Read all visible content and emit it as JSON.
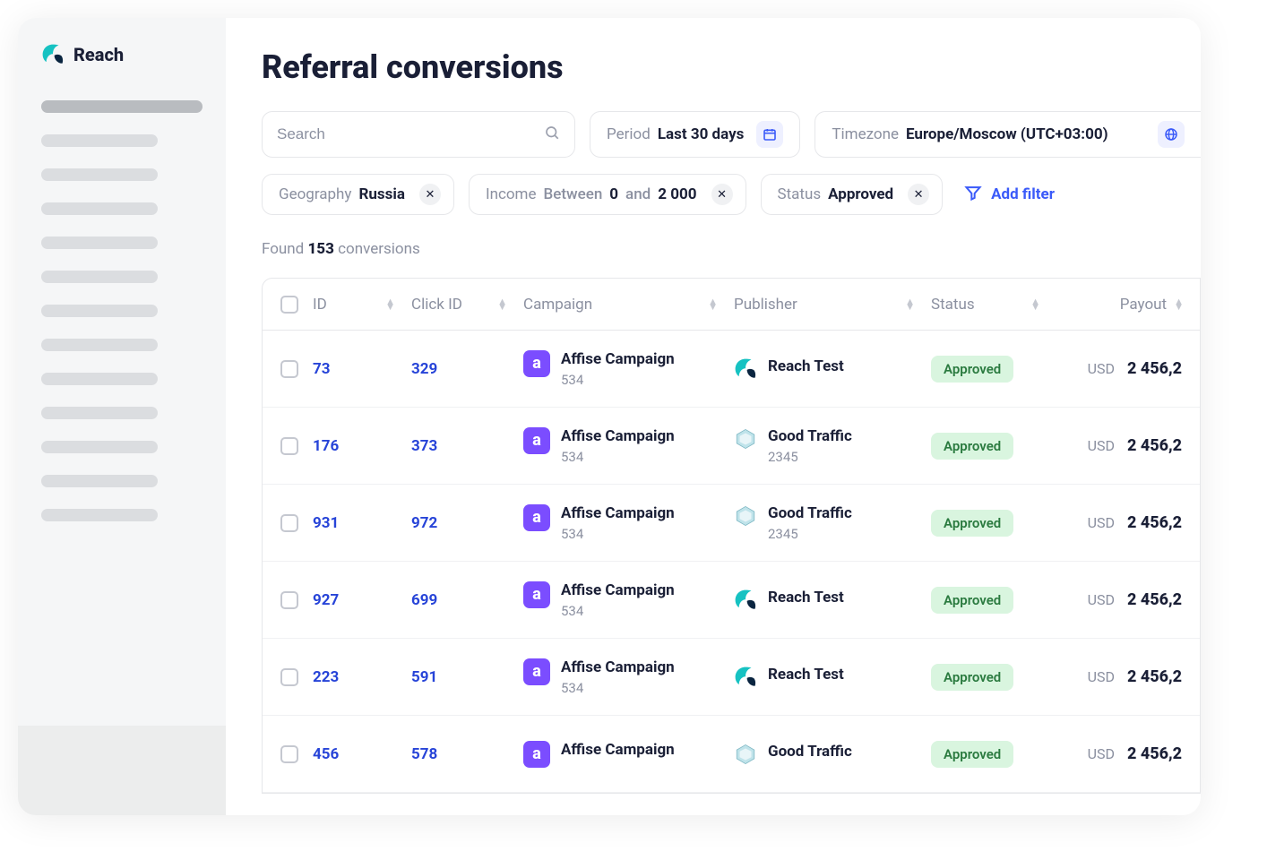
{
  "app_name": "Reach",
  "page_title": "Referral conversions",
  "search": {
    "placeholder": "Search"
  },
  "period": {
    "label": "Period",
    "value": "Last 30 days"
  },
  "timezone": {
    "label": "Timezone",
    "value": "Europe/Moscow (UTC+03:00)"
  },
  "filters": {
    "geography": {
      "label": "Geography",
      "value": "Russia"
    },
    "income": {
      "label": "Income",
      "between": "Between",
      "low": "0",
      "and": "and",
      "high": "2 000"
    },
    "status": {
      "label": "Status",
      "value": "Approved"
    }
  },
  "add_filter_label": "Add filter",
  "found": {
    "prefix": "Found",
    "count": "153",
    "suffix": "conversions"
  },
  "columns": {
    "id": "ID",
    "click_id": "Click ID",
    "campaign": "Campaign",
    "publisher": "Publisher",
    "status": "Status",
    "payout": "Payout"
  },
  "rows": [
    {
      "id": "73",
      "click_id": "329",
      "campaign_name": "Affise Campaign",
      "campaign_sub": "534",
      "publisher_name": "Reach Test",
      "publisher_sub": "",
      "publisher_logo": "reach",
      "status": "Approved",
      "payout_currency": "USD",
      "payout_value": "2 456,2"
    },
    {
      "id": "176",
      "click_id": "373",
      "campaign_name": "Affise Campaign",
      "campaign_sub": "534",
      "publisher_name": "Good Traffic",
      "publisher_sub": "2345",
      "publisher_logo": "gt",
      "status": "Approved",
      "payout_currency": "USD",
      "payout_value": "2 456,2"
    },
    {
      "id": "931",
      "click_id": "972",
      "campaign_name": "Affise Campaign",
      "campaign_sub": "534",
      "publisher_name": "Good Traffic",
      "publisher_sub": "2345",
      "publisher_logo": "gt",
      "status": "Approved",
      "payout_currency": "USD",
      "payout_value": "2 456,2"
    },
    {
      "id": "927",
      "click_id": "699",
      "campaign_name": "Affise Campaign",
      "campaign_sub": "534",
      "publisher_name": "Reach Test",
      "publisher_sub": "",
      "publisher_logo": "reach",
      "status": "Approved",
      "payout_currency": "USD",
      "payout_value": "2 456,2"
    },
    {
      "id": "223",
      "click_id": "591",
      "campaign_name": "Affise Campaign",
      "campaign_sub": "534",
      "publisher_name": "Reach Test",
      "publisher_sub": "",
      "publisher_logo": "reach",
      "status": "Approved",
      "payout_currency": "USD",
      "payout_value": "2 456,2"
    },
    {
      "id": "456",
      "click_id": "578",
      "campaign_name": "Affise Campaign",
      "campaign_sub": "",
      "publisher_name": "Good Traffic",
      "publisher_sub": "",
      "publisher_logo": "gt",
      "status": "Approved",
      "payout_currency": "USD",
      "payout_value": "2 456,2"
    }
  ]
}
